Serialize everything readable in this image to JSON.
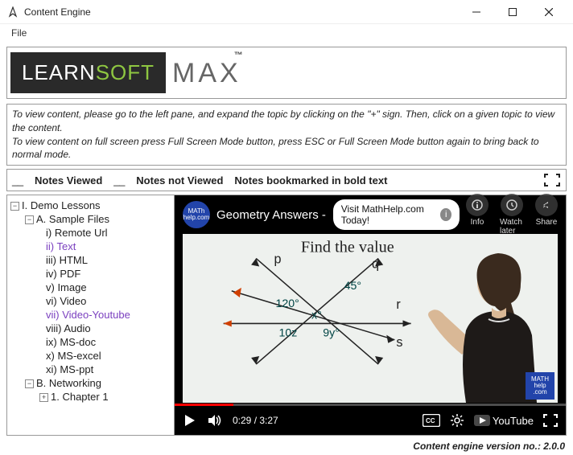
{
  "window": {
    "title": "Content Engine"
  },
  "menu": {
    "file": "File"
  },
  "logo": {
    "part1": "LEARN",
    "part2": "SOFT",
    "max": "MAX",
    "tm": "™"
  },
  "instructions": {
    "line1": "To view content, please go to the left pane, and expand the topic by clicking on the \"+\" sign.  Then, click on a given topic to view the content.",
    "line2": "To view content on full screen press Full Screen Mode button, press ESC or Full Screen Mode button again to bring back to normal mode."
  },
  "legend": {
    "viewed": "Notes Viewed",
    "notviewed": "Notes not Viewed",
    "bookmarked": "Notes bookmarked in bold text"
  },
  "tree": {
    "demo": "I. Demo Lessons",
    "sample": "A. Sample Files",
    "items": {
      "remote": "i) Remote Url",
      "text": "ii) Text",
      "html": "iii) HTML",
      "pdf": "iv) PDF",
      "image": "v) Image",
      "video": "vi) Video",
      "youtube": "vii) Video-Youtube",
      "audio": "viii) Audio",
      "msdoc": "ix) MS-doc",
      "msexcel": "x) MS-excel",
      "msppt": "xi) MS-ppt"
    },
    "networking": "B. Networking",
    "chapter1": "1. Chapter 1"
  },
  "video": {
    "channel": "MATh help.com",
    "title": "Geometry Answers - Ma",
    "promo": "Visit MathHelp.com Today!",
    "info": "Info",
    "watchlater": "Watch later",
    "share": "Share",
    "time": "0:29 / 3:27",
    "youtube": "YouTube",
    "board": {
      "heading": "Find the value",
      "p": "p",
      "q": "q",
      "r": "r",
      "s": "s",
      "a45": "45°",
      "a120": "120°",
      "ax": "x°",
      "a10z": "10z",
      "a9y": "9y°"
    },
    "mhlogo": {
      "l1": "MATH",
      "l2": "help",
      "l3": ".com"
    }
  },
  "footer": {
    "version": "Content engine version no.: 2.0.0"
  }
}
